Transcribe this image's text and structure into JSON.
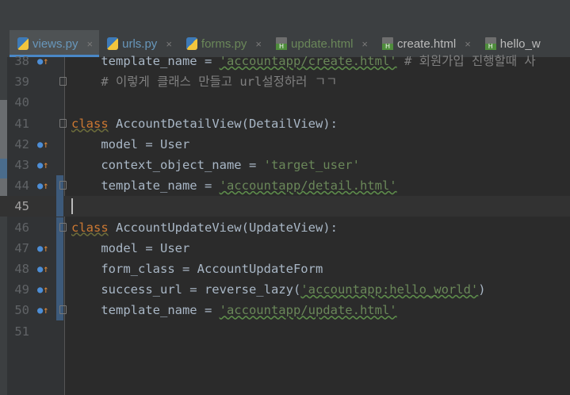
{
  "tabs": [
    {
      "label": "views.py",
      "icon": "python-file-icon",
      "active": true
    },
    {
      "label": "urls.py",
      "icon": "python-file-icon"
    },
    {
      "label": "forms.py",
      "icon": "python-file-icon"
    },
    {
      "label": "update.html",
      "icon": "html-file-icon"
    },
    {
      "label": "create.html",
      "icon": "html-file-icon"
    },
    {
      "label": "hello_w",
      "icon": "html-file-icon"
    }
  ],
  "close_glyph": "×",
  "lines": {
    "l38": {
      "n": "38",
      "a": "    template_name = ",
      "s": "'accountapp/create.html'",
      "c": " # 회원가입 진행할때 사"
    },
    "l39": {
      "n": "39",
      "c": "    # 이렇게 클래스 만들고 url설정하러 ㄱㄱ"
    },
    "l40": {
      "n": "40"
    },
    "l41": {
      "n": "41",
      "k": "class",
      "a": " AccountDetailView(DetailView):"
    },
    "l42": {
      "n": "42",
      "a": "    model = User"
    },
    "l43": {
      "n": "43",
      "a": "    context_object_name = ",
      "s": "'target_user'"
    },
    "l44": {
      "n": "44",
      "a": "    template_name = ",
      "s": "'accountapp/detail.html'"
    },
    "l45": {
      "n": "45"
    },
    "l46": {
      "n": "46",
      "k": "class",
      "a": " AccountUpdateView(UpdateView):"
    },
    "l47": {
      "n": "47",
      "a": "    model = User"
    },
    "l48": {
      "n": "48",
      "a": "    form_class = AccountUpdateForm"
    },
    "l49": {
      "n": "49",
      "a": "    success_url = reverse_lazy(",
      "s": "'accountapp:hello_world'",
      "e": ")"
    },
    "l50": {
      "n": "50",
      "a": "    template_name = ",
      "s": "'accountapp/update.html'"
    },
    "l51": {
      "n": "51"
    }
  }
}
